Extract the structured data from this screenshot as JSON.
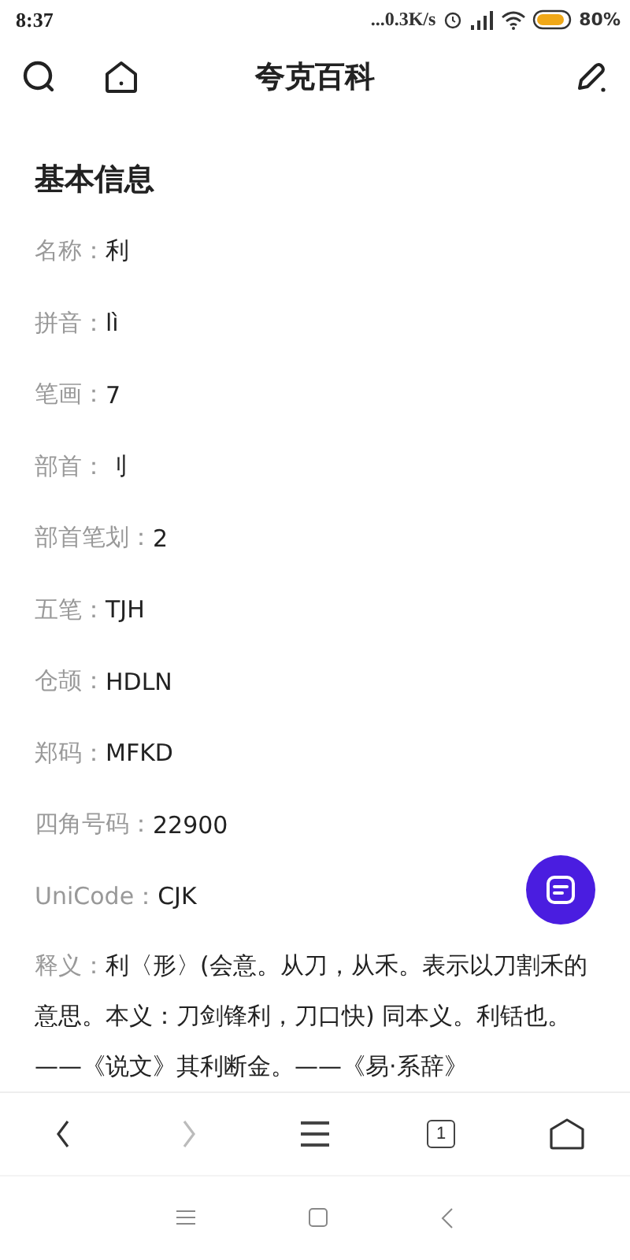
{
  "status_bar": {
    "time": "8:37",
    "network_speed": "...0.3K/s",
    "battery": "80%"
  },
  "header": {
    "title": "夸克百科"
  },
  "section": {
    "title": "基本信息"
  },
  "fields": [
    {
      "label": "名称：",
      "value": "利"
    },
    {
      "label": "拼音：",
      "value": "lì"
    },
    {
      "label": "笔画：",
      "value": "7"
    },
    {
      "label": "部首：",
      "value": " 刂"
    },
    {
      "label": "部首笔划：",
      "value": "2"
    },
    {
      "label": "五笔：",
      "value": "TJH"
    },
    {
      "label": "仓颉：",
      "value": "HDLN"
    },
    {
      "label": "郑码：",
      "value": "MFKD"
    },
    {
      "label": "四角号码：",
      "value": "22900"
    },
    {
      "label": "UniCode：",
      "value": "CJK"
    }
  ],
  "definition": {
    "label": "释义：",
    "text": "利〈形〉(会意。从刀，从禾。表示以刀割禾的意思。本义：刀剑锋利，刀口快) 同本义。利铦也。——《说文》其利断金。——《易·系辞》"
  },
  "bottom_nav": {
    "back_disabled": false,
    "forward_disabled": true,
    "tab_count": "1"
  }
}
